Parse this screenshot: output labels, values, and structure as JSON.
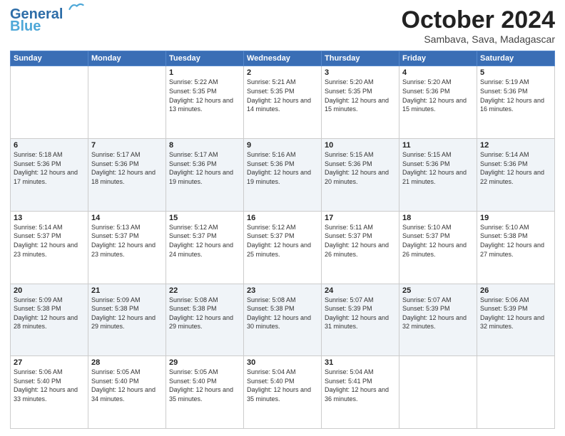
{
  "header": {
    "logo_line1": "General",
    "logo_line2": "Blue",
    "month": "October 2024",
    "location": "Sambava, Sava, Madagascar"
  },
  "weekdays": [
    "Sunday",
    "Monday",
    "Tuesday",
    "Wednesday",
    "Thursday",
    "Friday",
    "Saturday"
  ],
  "weeks": [
    [
      {
        "day": "",
        "info": ""
      },
      {
        "day": "",
        "info": ""
      },
      {
        "day": "1",
        "info": "Sunrise: 5:22 AM\nSunset: 5:35 PM\nDaylight: 12 hours and 13 minutes."
      },
      {
        "day": "2",
        "info": "Sunrise: 5:21 AM\nSunset: 5:35 PM\nDaylight: 12 hours and 14 minutes."
      },
      {
        "day": "3",
        "info": "Sunrise: 5:20 AM\nSunset: 5:35 PM\nDaylight: 12 hours and 15 minutes."
      },
      {
        "day": "4",
        "info": "Sunrise: 5:20 AM\nSunset: 5:36 PM\nDaylight: 12 hours and 15 minutes."
      },
      {
        "day": "5",
        "info": "Sunrise: 5:19 AM\nSunset: 5:36 PM\nDaylight: 12 hours and 16 minutes."
      }
    ],
    [
      {
        "day": "6",
        "info": "Sunrise: 5:18 AM\nSunset: 5:36 PM\nDaylight: 12 hours and 17 minutes."
      },
      {
        "day": "7",
        "info": "Sunrise: 5:17 AM\nSunset: 5:36 PM\nDaylight: 12 hours and 18 minutes."
      },
      {
        "day": "8",
        "info": "Sunrise: 5:17 AM\nSunset: 5:36 PM\nDaylight: 12 hours and 19 minutes."
      },
      {
        "day": "9",
        "info": "Sunrise: 5:16 AM\nSunset: 5:36 PM\nDaylight: 12 hours and 19 minutes."
      },
      {
        "day": "10",
        "info": "Sunrise: 5:15 AM\nSunset: 5:36 PM\nDaylight: 12 hours and 20 minutes."
      },
      {
        "day": "11",
        "info": "Sunrise: 5:15 AM\nSunset: 5:36 PM\nDaylight: 12 hours and 21 minutes."
      },
      {
        "day": "12",
        "info": "Sunrise: 5:14 AM\nSunset: 5:36 PM\nDaylight: 12 hours and 22 minutes."
      }
    ],
    [
      {
        "day": "13",
        "info": "Sunrise: 5:14 AM\nSunset: 5:37 PM\nDaylight: 12 hours and 23 minutes."
      },
      {
        "day": "14",
        "info": "Sunrise: 5:13 AM\nSunset: 5:37 PM\nDaylight: 12 hours and 23 minutes."
      },
      {
        "day": "15",
        "info": "Sunrise: 5:12 AM\nSunset: 5:37 PM\nDaylight: 12 hours and 24 minutes."
      },
      {
        "day": "16",
        "info": "Sunrise: 5:12 AM\nSunset: 5:37 PM\nDaylight: 12 hours and 25 minutes."
      },
      {
        "day": "17",
        "info": "Sunrise: 5:11 AM\nSunset: 5:37 PM\nDaylight: 12 hours and 26 minutes."
      },
      {
        "day": "18",
        "info": "Sunrise: 5:10 AM\nSunset: 5:37 PM\nDaylight: 12 hours and 26 minutes."
      },
      {
        "day": "19",
        "info": "Sunrise: 5:10 AM\nSunset: 5:38 PM\nDaylight: 12 hours and 27 minutes."
      }
    ],
    [
      {
        "day": "20",
        "info": "Sunrise: 5:09 AM\nSunset: 5:38 PM\nDaylight: 12 hours and 28 minutes."
      },
      {
        "day": "21",
        "info": "Sunrise: 5:09 AM\nSunset: 5:38 PM\nDaylight: 12 hours and 29 minutes."
      },
      {
        "day": "22",
        "info": "Sunrise: 5:08 AM\nSunset: 5:38 PM\nDaylight: 12 hours and 29 minutes."
      },
      {
        "day": "23",
        "info": "Sunrise: 5:08 AM\nSunset: 5:38 PM\nDaylight: 12 hours and 30 minutes."
      },
      {
        "day": "24",
        "info": "Sunrise: 5:07 AM\nSunset: 5:39 PM\nDaylight: 12 hours and 31 minutes."
      },
      {
        "day": "25",
        "info": "Sunrise: 5:07 AM\nSunset: 5:39 PM\nDaylight: 12 hours and 32 minutes."
      },
      {
        "day": "26",
        "info": "Sunrise: 5:06 AM\nSunset: 5:39 PM\nDaylight: 12 hours and 32 minutes."
      }
    ],
    [
      {
        "day": "27",
        "info": "Sunrise: 5:06 AM\nSunset: 5:40 PM\nDaylight: 12 hours and 33 minutes."
      },
      {
        "day": "28",
        "info": "Sunrise: 5:05 AM\nSunset: 5:40 PM\nDaylight: 12 hours and 34 minutes."
      },
      {
        "day": "29",
        "info": "Sunrise: 5:05 AM\nSunset: 5:40 PM\nDaylight: 12 hours and 35 minutes."
      },
      {
        "day": "30",
        "info": "Sunrise: 5:04 AM\nSunset: 5:40 PM\nDaylight: 12 hours and 35 minutes."
      },
      {
        "day": "31",
        "info": "Sunrise: 5:04 AM\nSunset: 5:41 PM\nDaylight: 12 hours and 36 minutes."
      },
      {
        "day": "",
        "info": ""
      },
      {
        "day": "",
        "info": ""
      }
    ]
  ]
}
